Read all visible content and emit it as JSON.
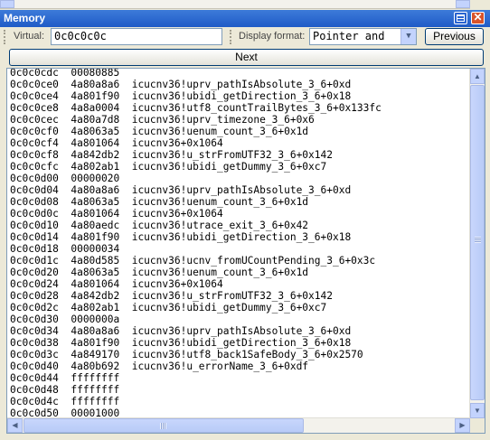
{
  "window": {
    "title": "Memory"
  },
  "toolbar": {
    "virtual_label": "Virtual:",
    "virtual_value": "0c0c0c0c",
    "display_format_label": "Display format:",
    "display_format_value": "Pointer and",
    "previous_label": "Previous",
    "next_label": "Next"
  },
  "memory_lines": [
    "0c0c0cdc  00080885",
    "0c0c0ce0  4a80a8a6  icucnv36!uprv_pathIsAbsolute_3_6+0xd",
    "0c0c0ce4  4a801f90  icucnv36!ubidi_getDirection_3_6+0x18",
    "0c0c0ce8  4a8a0004  icucnv36!utf8_countTrailBytes_3_6+0x133fc",
    "0c0c0cec  4a80a7d8  icucnv36!uprv_timezone_3_6+0x6",
    "0c0c0cf0  4a8063a5  icucnv36!uenum_count_3_6+0x1d",
    "0c0c0cf4  4a801064  icucnv36+0x1064",
    "0c0c0cf8  4a842db2  icucnv36!u_strFromUTF32_3_6+0x142",
    "0c0c0cfc  4a802ab1  icucnv36!ubidi_getDummy_3_6+0xc7",
    "0c0c0d00  00000020",
    "0c0c0d04  4a80a8a6  icucnv36!uprv_pathIsAbsolute_3_6+0xd",
    "0c0c0d08  4a8063a5  icucnv36!uenum_count_3_6+0x1d",
    "0c0c0d0c  4a801064  icucnv36+0x1064",
    "0c0c0d10  4a80aedc  icucnv36!utrace_exit_3_6+0x42",
    "0c0c0d14  4a801f90  icucnv36!ubidi_getDirection_3_6+0x18",
    "0c0c0d18  00000034",
    "0c0c0d1c  4a80d585  icucnv36!ucnv_fromUCountPending_3_6+0x3c",
    "0c0c0d20  4a8063a5  icucnv36!uenum_count_3_6+0x1d",
    "0c0c0d24  4a801064  icucnv36+0x1064",
    "0c0c0d28  4a842db2  icucnv36!u_strFromUTF32_3_6+0x142",
    "0c0c0d2c  4a802ab1  icucnv36!ubidi_getDummy_3_6+0xc7",
    "0c0c0d30  0000000a",
    "0c0c0d34  4a80a8a6  icucnv36!uprv_pathIsAbsolute_3_6+0xd",
    "0c0c0d38  4a801f90  icucnv36!ubidi_getDirection_3_6+0x18",
    "0c0c0d3c  4a849170  icucnv36!utf8_back1SafeBody_3_6+0x2570",
    "0c0c0d40  4a80b692  icucnv36!u_errorName_3_6+0xdf",
    "0c0c0d44  ffffffff",
    "0c0c0d48  ffffffff",
    "0c0c0d4c  ffffffff",
    "0c0c0d50  00001000"
  ],
  "icons": {
    "grid": "grid-icon",
    "close": "close-icon",
    "dropdown": "chevron-down-icon"
  },
  "colors": {
    "titlebar": "#2a64d0",
    "close_button": "#d8532a",
    "face": "#ece9d8"
  }
}
